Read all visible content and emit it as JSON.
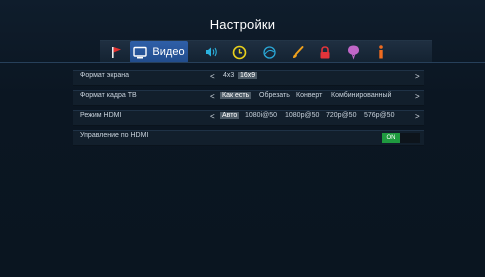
{
  "header": {
    "title": "Настройки"
  },
  "tabs": [
    {
      "icon": "flag-icon"
    },
    {
      "icon": "monitor-icon",
      "label": "Видео",
      "active": true
    },
    {
      "icon": "sound-icon"
    },
    {
      "icon": "clock-icon"
    },
    {
      "icon": "satellite-icon"
    },
    {
      "icon": "brush-icon"
    },
    {
      "icon": "lock-icon"
    },
    {
      "icon": "balloon-icon"
    },
    {
      "icon": "info-icon"
    }
  ],
  "rows": [
    {
      "label": "Формат экрана",
      "options": [
        "4x3",
        "16x9"
      ],
      "selected": "16x9"
    },
    {
      "label": "Формат кадра ТВ",
      "options": [
        "Как есть",
        "Обрезать",
        "Конверт",
        "Комбинированный"
      ],
      "selected": "Как есть"
    },
    {
      "label": "Режим HDMI",
      "options": [
        "Авто",
        "1080i@50",
        "1080p@50",
        "720p@50",
        "576p@50"
      ],
      "selected": "Авто"
    },
    {
      "label": "Управление по HDMI",
      "toggle": "ON"
    }
  ],
  "colors": {
    "accent": "#2f5fa8",
    "toggle_on": "#1f9a3f"
  }
}
